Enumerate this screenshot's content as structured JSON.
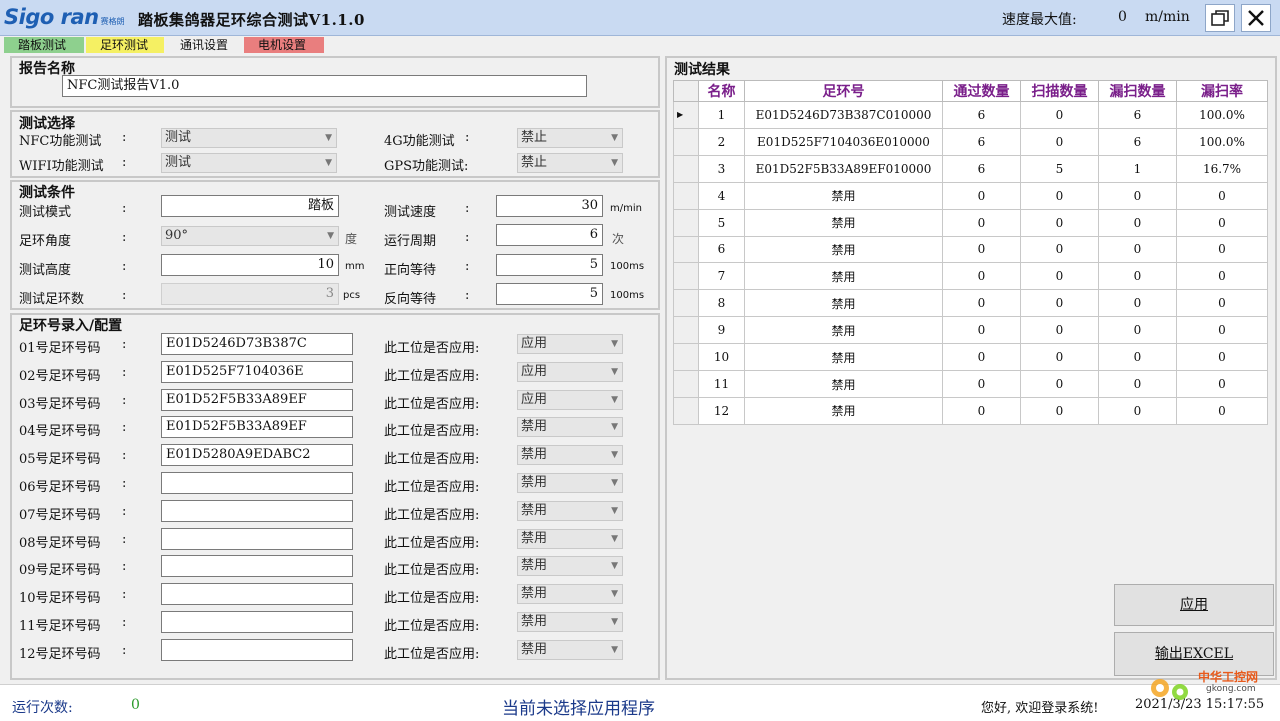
{
  "app": {
    "logo_text": "Sigo ran",
    "logo_sub": "赛格朗",
    "title": "踏板集鸽器足环综合测试V1.1.0",
    "speed_max_label": "速度最大值:",
    "speed_max_value": "0",
    "speed_unit": "m/min"
  },
  "tabs": [
    {
      "label": "踏板测试"
    },
    {
      "label": "足环测试"
    },
    {
      "label": "通讯设置"
    },
    {
      "label": "电机设置"
    }
  ],
  "report": {
    "section_title": "报告名称",
    "name_value": "NFC测试报告V1.0"
  },
  "test_select": {
    "section_title": "测试选择",
    "nfc_label": "NFC功能测试",
    "nfc_value": "测试",
    "wifi_label": "WIFI功能测试",
    "wifi_value": "测试",
    "g4_label": "4G功能测试",
    "g4_value": "禁止",
    "gps_label": "GPS功能测试:",
    "gps_value": "禁止",
    "colon": ":"
  },
  "conditions": {
    "section_title": "测试条件",
    "mode_label": "测试模式",
    "mode_value": "踏板",
    "angle_label": "足环角度",
    "angle_value": "90°",
    "angle_unit": "度",
    "height_label": "测试高度",
    "height_value": "10",
    "height_unit": "mm",
    "count_label": "测试足环数",
    "count_value": "3",
    "count_unit": "pcs",
    "speed_label": "测试速度",
    "speed_value": "30",
    "speed_unit": "m/min",
    "period_label": "运行周期",
    "period_value": "6",
    "period_unit": "次",
    "fwd_label": "正向等待",
    "fwd_value": "5",
    "fwd_unit": "100ms",
    "rev_label": "反向等待",
    "rev_value": "5",
    "rev_unit": "100ms"
  },
  "config": {
    "section_title": "足环号录入/配置",
    "apply_question": "此工位是否应用:",
    "rows": [
      {
        "label": "01号足环号码",
        "code": "E01D5246D73B387C",
        "apply": "应用"
      },
      {
        "label": "02号足环号码",
        "code": "E01D525F7104036E",
        "apply": "应用"
      },
      {
        "label": "03号足环号码",
        "code": "E01D52F5B33A89EF",
        "apply": "应用"
      },
      {
        "label": "04号足环号码",
        "code": "E01D52F5B33A89EF",
        "apply": "禁用"
      },
      {
        "label": "05号足环号码",
        "code": "E01D5280A9EDABC2",
        "apply": "禁用"
      },
      {
        "label": "06号足环号码",
        "code": "",
        "apply": "禁用"
      },
      {
        "label": "07号足环号码",
        "code": "",
        "apply": "禁用"
      },
      {
        "label": "08号足环号码",
        "code": "",
        "apply": "禁用"
      },
      {
        "label": "09号足环号码",
        "code": "",
        "apply": "禁用"
      },
      {
        "label": "10号足环号码",
        "code": "",
        "apply": "禁用"
      },
      {
        "label": "11号足环号码",
        "code": "",
        "apply": "禁用"
      },
      {
        "label": "12号足环号码",
        "code": "",
        "apply": "禁用"
      }
    ]
  },
  "results": {
    "section_title": "测试结果",
    "columns": [
      "名称",
      "足环号",
      "通过数量",
      "扫描数量",
      "漏扫数量",
      "漏扫率"
    ],
    "rows": [
      [
        "1",
        "E01D5246D73B387C010000",
        "6",
        "0",
        "6",
        "100.0%"
      ],
      [
        "2",
        "E01D525F7104036E010000",
        "6",
        "0",
        "6",
        "100.0%"
      ],
      [
        "3",
        "E01D52F5B33A89EF010000",
        "6",
        "5",
        "1",
        "16.7%"
      ],
      [
        "4",
        "禁用",
        "0",
        "0",
        "0",
        "0"
      ],
      [
        "5",
        "禁用",
        "0",
        "0",
        "0",
        "0"
      ],
      [
        "6",
        "禁用",
        "0",
        "0",
        "0",
        "0"
      ],
      [
        "7",
        "禁用",
        "0",
        "0",
        "0",
        "0"
      ],
      [
        "8",
        "禁用",
        "0",
        "0",
        "0",
        "0"
      ],
      [
        "9",
        "禁用",
        "0",
        "0",
        "0",
        "0"
      ],
      [
        "10",
        "禁用",
        "0",
        "0",
        "0",
        "0"
      ],
      [
        "11",
        "禁用",
        "0",
        "0",
        "0",
        "0"
      ],
      [
        "12",
        "禁用",
        "0",
        "0",
        "0",
        "0"
      ]
    ]
  },
  "buttons": {
    "apply": "应用",
    "export": "输出EXCEL"
  },
  "status": {
    "run_count_label": "运行次数:",
    "run_count_value": "0",
    "message": "当前未选择应用程序",
    "welcome": "您好, 欢迎登录系统!",
    "clock": "2021/3/23 15:17:55"
  },
  "watermark": {
    "text": "中华工控网",
    "url": "gkong.com"
  }
}
